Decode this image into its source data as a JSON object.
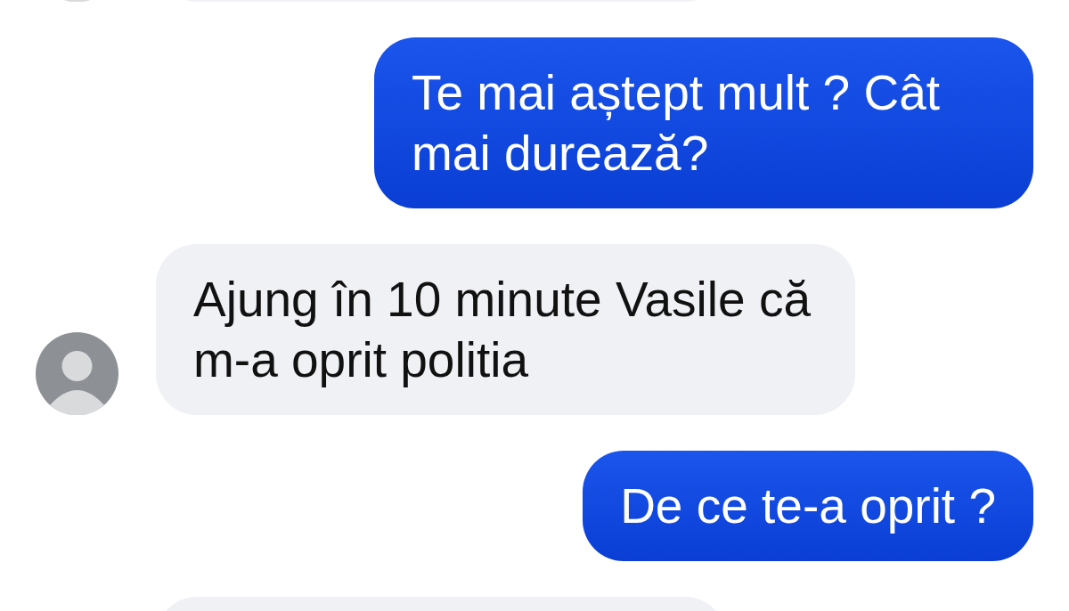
{
  "messages": [
    {
      "kind": "received",
      "avatar": true
    },
    {
      "kind": "sent",
      "text": "Te mai aștept mult ? Cât mai durează?"
    },
    {
      "kind": "received",
      "avatar": true,
      "text": "Ajung în 10 minute Vasile că m-a oprit politia"
    },
    {
      "kind": "sent",
      "text": "De ce te-a oprit ?"
    },
    {
      "kind": "received",
      "avatar": false
    }
  ]
}
